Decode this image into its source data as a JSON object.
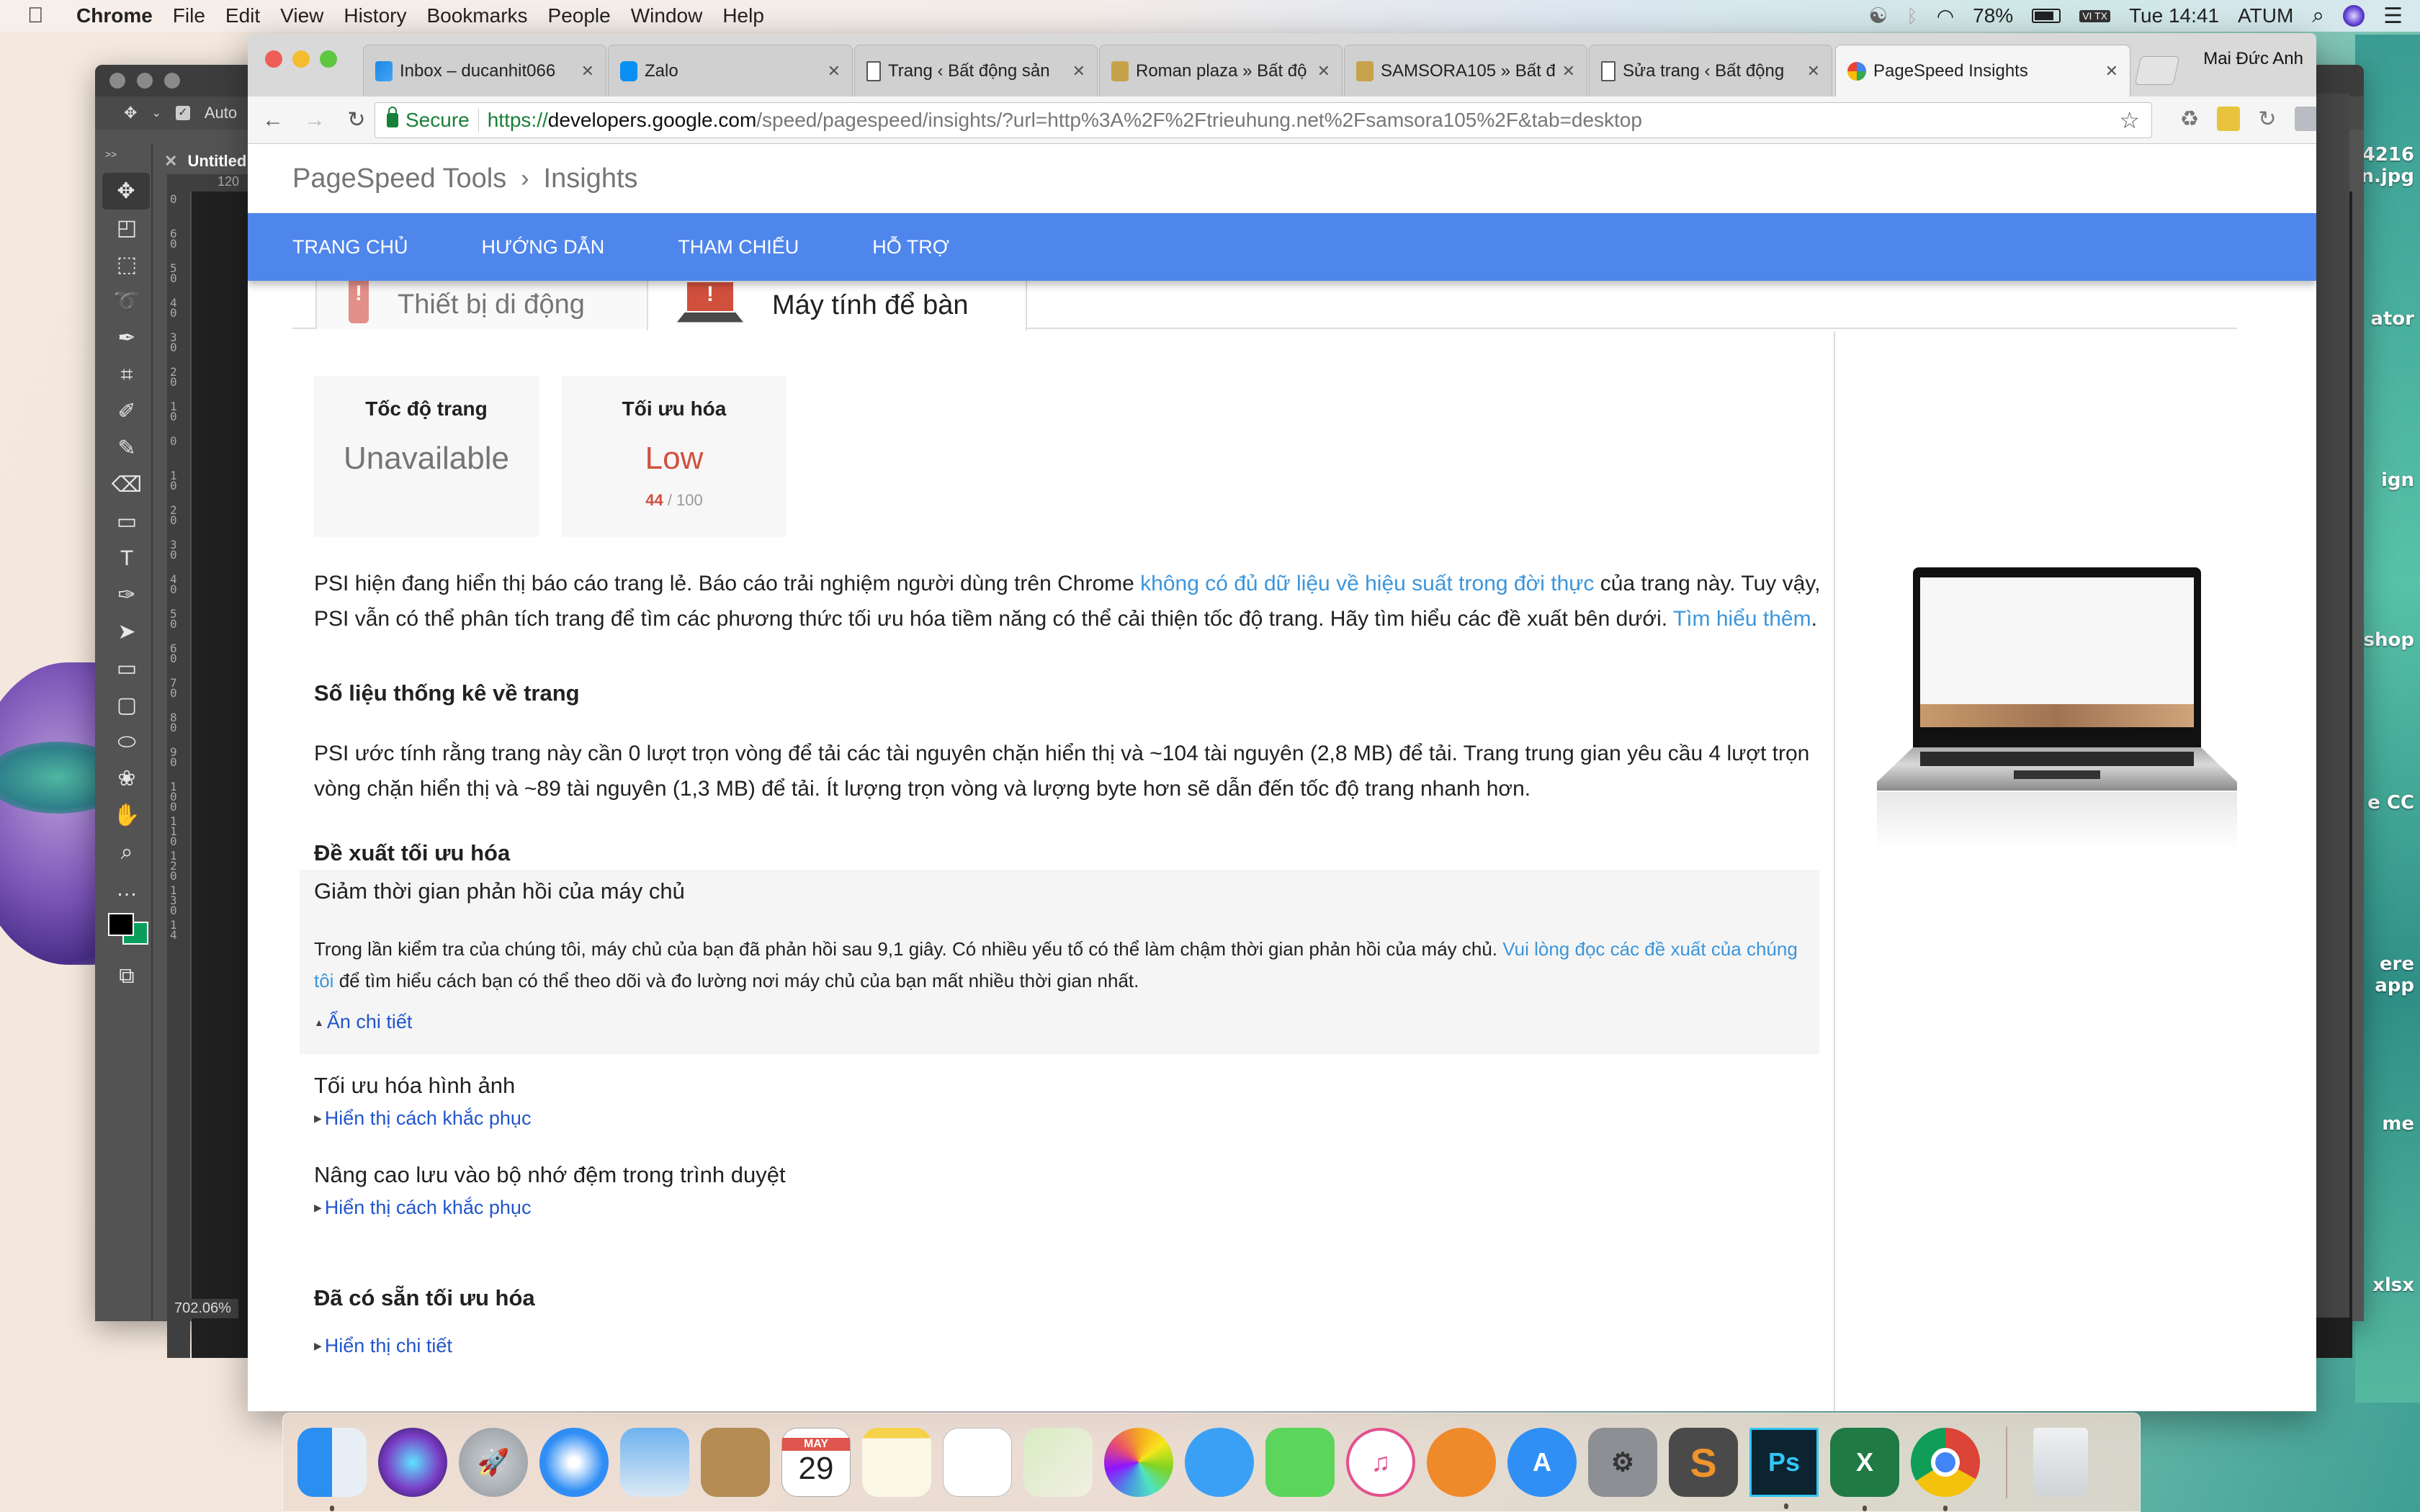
{
  "menubar": {
    "app_name": "Chrome",
    "menus": [
      "File",
      "Edit",
      "View",
      "History",
      "Bookmarks",
      "People",
      "Window",
      "Help"
    ],
    "battery": "78%",
    "input_method": "VI TX",
    "clock": "Tue 14:41",
    "user": "ATUM"
  },
  "photoshop": {
    "options_checkbox_label": "Auto",
    "doc_tab": "Untitled",
    "ruler_h_label": "120",
    "ruler_v_labels": [
      "0",
      "60",
      "50",
      "40",
      "30",
      "20",
      "10",
      "0",
      "10",
      "20",
      "30",
      "40",
      "50",
      "60",
      "70",
      "80",
      "90",
      "100",
      "110",
      "120",
      "130",
      "14"
    ],
    "zoom": "702.06%",
    "tools": [
      "move",
      "artboard",
      "marquee",
      "lasso",
      "quick-select",
      "crop",
      "eyedropper",
      "brush",
      "eraser",
      "gradient",
      "type",
      "pen",
      "path-select",
      "rectangle",
      "rounded-rect",
      "ellipse",
      "custom-shape",
      "hand",
      "zoom",
      "more"
    ],
    "foreground_color": "#000000",
    "background_color": "#0a9e5c"
  },
  "desktop_labels": [
    "4216",
    "n.jpg",
    "ator",
    "ign",
    "shop",
    "e CC",
    "ere",
    "app",
    "me",
    "xlsx"
  ],
  "browser": {
    "tabs": [
      {
        "title": "Inbox – ducanhit066",
        "icon": "inbox-icon"
      },
      {
        "title": "Zalo",
        "icon": "zalo-icon"
      },
      {
        "title": "Trang ‹ Bất động sản",
        "icon": "page-icon"
      },
      {
        "title": "Roman plaza » Bất độ",
        "icon": "h-icon"
      },
      {
        "title": "SAMSORA105 » Bất đ",
        "icon": "h-icon"
      },
      {
        "title": "Sửa trang ‹ Bất động",
        "icon": "page-icon"
      },
      {
        "title": "PageSpeed Insights",
        "icon": "pagespeed-icon",
        "active": true
      }
    ],
    "profile": "Mai Đức Anh",
    "secure_label": "Secure",
    "url_scheme": "https://",
    "url_host": "developers.google.com",
    "url_rest": "/speed/pagespeed/insights/?url=http%3A%2F%2Ftrieuhung.net%2Fsamsora105%2F&tab=desktop",
    "extensions": [
      "recycle-icon",
      "lastpass-icon",
      "sync-icon",
      "code-icon",
      "sheets-icon",
      "translate-icon",
      "sq-icon",
      "hola-icon"
    ]
  },
  "psi": {
    "breadcrumb": {
      "root": "PageSpeed Tools",
      "current": "Insights"
    },
    "nav": [
      "TRANG CHỦ",
      "HƯỚNG DẪN",
      "THAM CHIẾU",
      "HỖ TRỢ"
    ],
    "device_tabs": {
      "mobile": "Thiết bị di động",
      "desktop": "Máy tính để bàn",
      "active": "desktop"
    },
    "cards": {
      "speed": {
        "title": "Tốc độ trang",
        "value": "Unavailable"
      },
      "optimization": {
        "title": "Tối ưu hóa",
        "value": "Low",
        "score": "44",
        "max": "/ 100"
      }
    },
    "intro": {
      "text1": "PSI hiện đang hiển thị báo cáo trang lẻ. Báo cáo trải nghiệm người dùng trên Chrome ",
      "link1": "không có đủ dữ liệu về hiệu suất trong đời thực",
      "text2": " của trang này. Tuy vậy, PSI vẫn có thể phân tích trang để tìm các phương thức tối ưu hóa tiềm năng có thể cải thiện tốc độ trang. Hãy tìm hiểu các đề xuất bên dưới. ",
      "link2": "Tìm hiểu thêm",
      "text3": "."
    },
    "stats": {
      "heading": "Số liệu thống kê về trang",
      "text": "PSI ước tính rằng trang này cần 0 lượt trọn vòng để tải các tài nguyên chặn hiển thị và ~104 tài nguyên (2,8 MB) để tải. Trang trung gian yêu cầu 4 lượt trọn vòng chặn hiển thị và ~89 tài nguyên (1,3 MB) để tải. Ít lượng trọn vòng và lượng byte hơn sẽ dẫn đến tốc độ trang nhanh hơn."
    },
    "suggestions": {
      "heading": "Đề xuất tối ưu hóa",
      "expanded_rule": {
        "title": "Giảm thời gian phản hồi của máy chủ",
        "text1": "Trong lần kiểm tra của chúng tôi, máy chủ của bạn đã phản hồi sau 9,1 giây. Có nhiều yếu tố có thể làm chậm thời gian phản hồi của máy chủ. ",
        "link": "Vui lòng đọc các đề xuất của chúng tôi",
        "text2": " để tìm hiểu cách bạn có thể theo dõi và đo lường nơi máy chủ của bạn mất nhiều thời gian nhất.",
        "toggle": "Ẩn chi tiết"
      },
      "rules": [
        {
          "title": "Tối ưu hóa hình ảnh",
          "toggle": "Hiển thị cách khắc phục"
        },
        {
          "title": "Nâng cao lưu vào bộ nhớ đệm trong trình duyệt",
          "toggle": "Hiển thị cách khắc phục"
        }
      ]
    },
    "passed": {
      "heading": "Đã có sẵn tối ưu hóa",
      "toggle": "Hiển thị chi tiết"
    }
  },
  "dock": {
    "apps": [
      "Finder",
      "Siri",
      "Launchpad",
      "Safari",
      "Mail",
      "Contacts",
      "Calendar",
      "Notes",
      "Reminders",
      "Maps",
      "Photos",
      "Messages",
      "FaceTime",
      "iTunes",
      "iBooks",
      "App Store",
      "System Preferences",
      "Sublime Text",
      "Photoshop",
      "Excel",
      "Chrome"
    ],
    "calendar_month": "MAY",
    "calendar_day": "29",
    "trash": "Trash"
  },
  "colors": {
    "nav_blue": "#4f86ec",
    "low_red": "#d14f3d",
    "link_blue": "#3b95db",
    "toggle_blue": "#2255cc"
  }
}
